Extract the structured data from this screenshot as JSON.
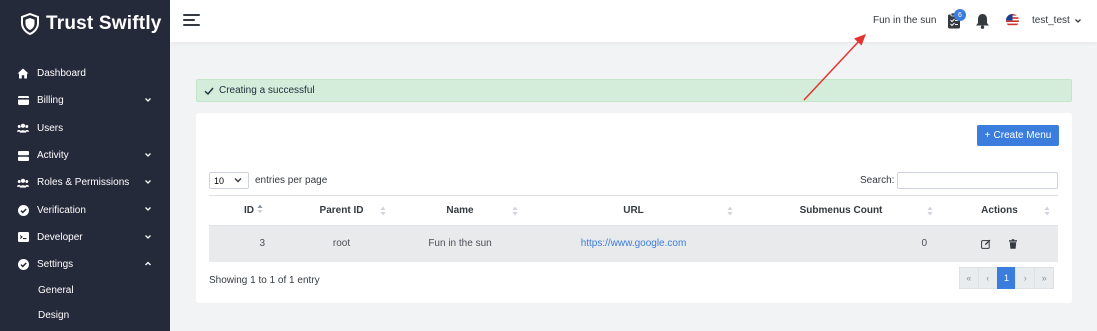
{
  "brand": {
    "name": "Trust Swiftly"
  },
  "sidebar": {
    "items": [
      {
        "label": "Dashboard",
        "icon": "home-icon",
        "has_submenu": false
      },
      {
        "label": "Billing",
        "icon": "billing-icon",
        "has_submenu": true
      },
      {
        "label": "Users",
        "icon": "users-icon",
        "has_submenu": false
      },
      {
        "label": "Activity",
        "icon": "activity-icon",
        "has_submenu": true
      },
      {
        "label": "Roles & Permissions",
        "icon": "roles-icon",
        "has_submenu": true
      },
      {
        "label": "Verification",
        "icon": "verification-icon",
        "has_submenu": true
      },
      {
        "label": "Developer",
        "icon": "developer-icon",
        "has_submenu": true
      },
      {
        "label": "Settings",
        "icon": "gear-icon",
        "has_submenu": true,
        "expanded": true
      }
    ],
    "sub_items": [
      {
        "label": "General"
      },
      {
        "label": "Design"
      }
    ]
  },
  "header": {
    "menu_text": "Fun in the sun",
    "badge_count": "6",
    "user_name": "test_test"
  },
  "alert": {
    "message": "Creating a successful"
  },
  "toolbar": {
    "create_label": "Create Menu"
  },
  "table_controls": {
    "length_value": "10",
    "entries_label": "entries per page",
    "search_label": "Search:",
    "search_value": ""
  },
  "table": {
    "columns": [
      "ID",
      "Parent ID",
      "Name",
      "URL",
      "Submenus Count",
      "Actions"
    ],
    "rows": [
      {
        "id": "3",
        "parent_id": "root",
        "name": "Fun in the sun",
        "url": "https://www.google.com",
        "submenus": "0"
      }
    ]
  },
  "footer": {
    "info": "Showing 1 to 1 of 1 entry",
    "pager": [
      "«",
      "‹",
      "1",
      "›",
      "»"
    ],
    "active_page": "1"
  },
  "colors": {
    "sidebar_bg": "#252a3a",
    "accent": "#3b7ddd",
    "alert_bg": "#d4edda",
    "annotation_arrow": "#e3342f"
  }
}
